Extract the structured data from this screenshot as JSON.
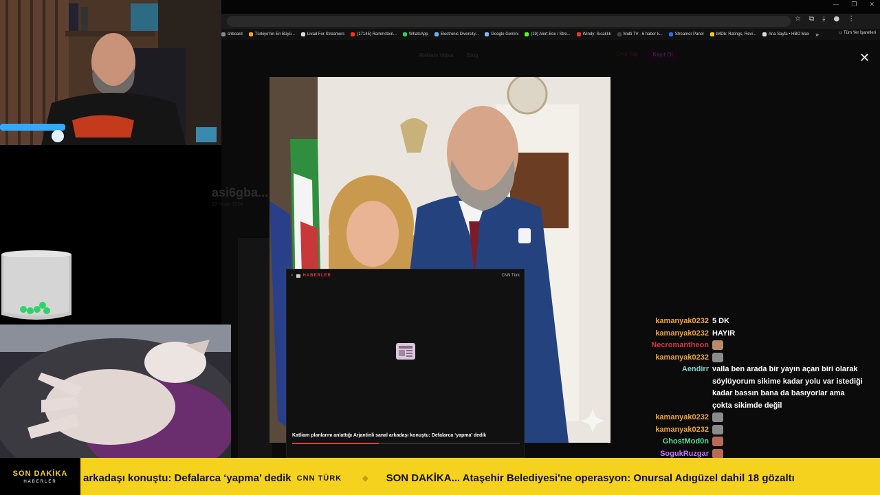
{
  "browser": {
    "window_controls": [
      "—",
      "❐",
      "✕"
    ],
    "bookmarks": [
      {
        "label": "shboard",
        "color": "#888"
      },
      {
        "label": "Türkiye'nin En Büyü...",
        "color": "#f5a623"
      },
      {
        "label": "Livad For Streamers",
        "color": "#ddd"
      },
      {
        "label": "(17145) Rammstein...",
        "color": "#ff2a2a"
      },
      {
        "label": "WhatsApp",
        "color": "#25d366"
      },
      {
        "label": "Electronic Diversity...",
        "color": "#6ab0ff"
      },
      {
        "label": "Google Gemini",
        "color": "#8ab4f8"
      },
      {
        "label": "(19) Alert Box / Stre...",
        "color": "#53fc18"
      },
      {
        "label": "Windy: Sıcaklık",
        "color": "#e33"
      },
      {
        "label": "Multi TV - 6 haber k...",
        "color": "#444"
      },
      {
        "label": "Streamer Panel",
        "color": "#2f6bff"
      },
      {
        "label": "IMDb: Ratings, Revi...",
        "color": "#f5c518"
      },
      {
        "label": "Ana Sayfa • HBO Max",
        "color": "#ddd"
      }
    ],
    "more": "»",
    "all_bookmarks": "Tüm Yer İşaretleri"
  },
  "site": {
    "nav": [
      "Reklam Videa",
      "Blog"
    ],
    "login": "Giriş Yap",
    "signup": "Kayıt Ol",
    "bg_title": "asi6gba...",
    "bg_date": "19 Nisan 2024",
    "close": "✕"
  },
  "news": {
    "brand": "HABERLER",
    "source": "CNN Türk",
    "headline": "Katliam planlarını anlattığı Arjantinli sanal arkadaşı konuştu: Defalarca ‘yapma’ dedik",
    "progress": 0.38
  },
  "chat": [
    {
      "user": "kamanyak0232",
      "color": "#f0a43c",
      "text": "5 DK"
    },
    {
      "user": "kamanyak0232",
      "color": "#f0a43c",
      "text": "HAYIR"
    },
    {
      "user": "Necromantheon",
      "color": "#d9314a",
      "text": "",
      "emote": "#b88a6a"
    },
    {
      "user": "kamanyak0232",
      "color": "#f0a43c",
      "text": "",
      "emote": "#8b8b8b"
    },
    {
      "user": "Aendirr",
      "color": "#7fd1c8",
      "text": "valla ben arada bir yayın açan biri olarak söylüyorum sikime kadar yolu var istediği kadar bassın bana da basıyorlar ama çokta sikimde değil"
    },
    {
      "user": "kamanyak0232",
      "color": "#f0a43c",
      "text": "",
      "emote": "#8b8b8b"
    },
    {
      "user": "kamanyak0232",
      "color": "#f0a43c",
      "text": "",
      "emote": "#8b8b8b"
    },
    {
      "user": "GhostMod0n",
      "color": "#56e09a",
      "text": "",
      "emote": "#b86a5a"
    },
    {
      "user": "SogukRuzgar",
      "color": "#c86cff",
      "text": "",
      "emote": "#b86a5a"
    }
  ],
  "ticker": {
    "label": "SON DAKİKA",
    "sublabel": "HABERLER",
    "item1": "arkadaşı konuştu: Defalarca ‘yapma’ dedik",
    "source1": "CNN TÜRK",
    "separator": "◆",
    "item2": "SON DAKİKA... Ataşehir Belediyesi'ne operasyon: Onursal Adıgüzel dahil 18 gözaltı"
  },
  "colors": {
    "ticker_bg": "#f5d21e",
    "accent_red": "#e23a3a"
  }
}
